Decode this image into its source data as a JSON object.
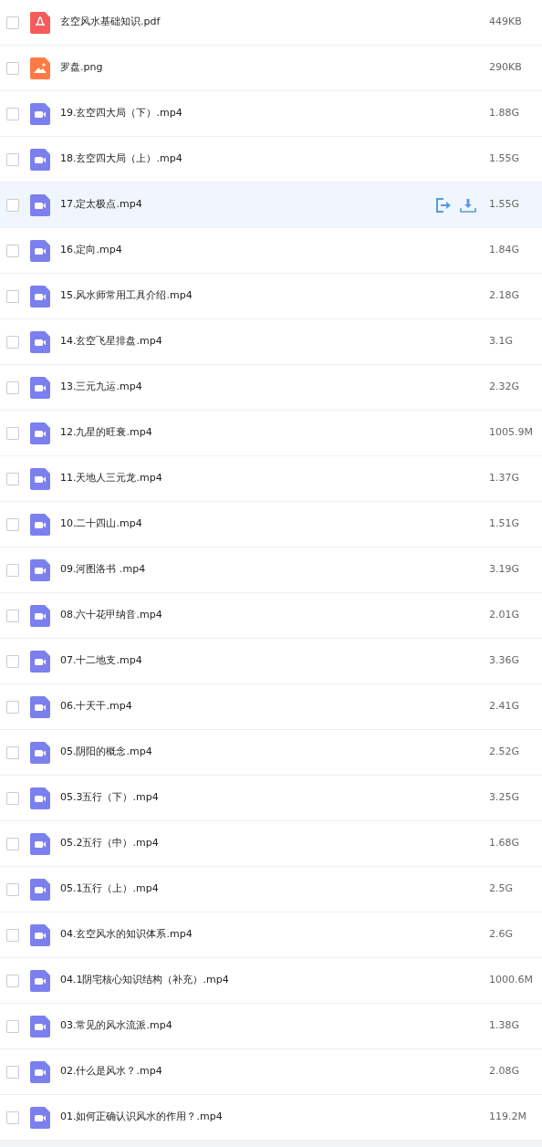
{
  "files": [
    {
      "name": "玄空风水基础知识.pdf",
      "size": "449KB",
      "kind": "pdf",
      "checked": false,
      "hovered": false
    },
    {
      "name": "罗盘.png",
      "size": "290KB",
      "kind": "image",
      "checked": false,
      "hovered": false
    },
    {
      "name": "19.玄空四大局（下）.mp4",
      "size": "1.88G",
      "kind": "video",
      "checked": false,
      "hovered": false
    },
    {
      "name": "18.玄空四大局（上）.mp4",
      "size": "1.55G",
      "kind": "video",
      "checked": false,
      "hovered": false
    },
    {
      "name": "17.定太极点.mp4",
      "size": "1.55G",
      "kind": "video",
      "checked": false,
      "hovered": true
    },
    {
      "name": "16.定向.mp4",
      "size": "1.84G",
      "kind": "video",
      "checked": false,
      "hovered": false
    },
    {
      "name": "15.风水师常用工具介绍.mp4",
      "size": "2.18G",
      "kind": "video",
      "checked": false,
      "hovered": false
    },
    {
      "name": "14.玄空飞星排盘.mp4",
      "size": "3.1G",
      "kind": "video",
      "checked": false,
      "hovered": false
    },
    {
      "name": "13.三元九运.mp4",
      "size": "2.32G",
      "kind": "video",
      "checked": false,
      "hovered": false
    },
    {
      "name": "12.九星的旺衰.mp4",
      "size": "1005.9M",
      "kind": "video",
      "checked": false,
      "hovered": false
    },
    {
      "name": "11.天地人三元龙.mp4",
      "size": "1.37G",
      "kind": "video",
      "checked": false,
      "hovered": false
    },
    {
      "name": "10.二十四山.mp4",
      "size": "1.51G",
      "kind": "video",
      "checked": false,
      "hovered": false
    },
    {
      "name": "09.河图洛书 .mp4",
      "size": "3.19G",
      "kind": "video",
      "checked": false,
      "hovered": false
    },
    {
      "name": "08.六十花甲纳音.mp4",
      "size": "2.01G",
      "kind": "video",
      "checked": false,
      "hovered": false
    },
    {
      "name": "07.十二地支.mp4",
      "size": "3.36G",
      "kind": "video",
      "checked": false,
      "hovered": false
    },
    {
      "name": "06.十天干.mp4",
      "size": "2.41G",
      "kind": "video",
      "checked": false,
      "hovered": false
    },
    {
      "name": "05.阴阳的概念.mp4",
      "size": "2.52G",
      "kind": "video",
      "checked": false,
      "hovered": false
    },
    {
      "name": "05.3五行（下）.mp4",
      "size": "3.25G",
      "kind": "video",
      "checked": false,
      "hovered": false
    },
    {
      "name": "05.2五行（中）.mp4",
      "size": "1.68G",
      "kind": "video",
      "checked": false,
      "hovered": false
    },
    {
      "name": "05.1五行（上）.mp4",
      "size": "2.5G",
      "kind": "video",
      "checked": false,
      "hovered": false
    },
    {
      "name": "04.玄空风水的知识体系.mp4",
      "size": "2.6G",
      "kind": "video",
      "checked": false,
      "hovered": false
    },
    {
      "name": "04.1阴宅核心知识结构（补充）.mp4",
      "size": "1000.6M",
      "kind": "video",
      "checked": false,
      "hovered": false
    },
    {
      "name": "03.常见的风水流派.mp4",
      "size": "1.38G",
      "kind": "video",
      "checked": false,
      "hovered": false
    },
    {
      "name": "02.什么是风水？.mp4",
      "size": "2.08G",
      "kind": "video",
      "checked": false,
      "hovered": false
    },
    {
      "name": "01.如何正确认识风水的作用？.mp4",
      "size": "119.2M",
      "kind": "video",
      "checked": false,
      "hovered": false
    }
  ]
}
